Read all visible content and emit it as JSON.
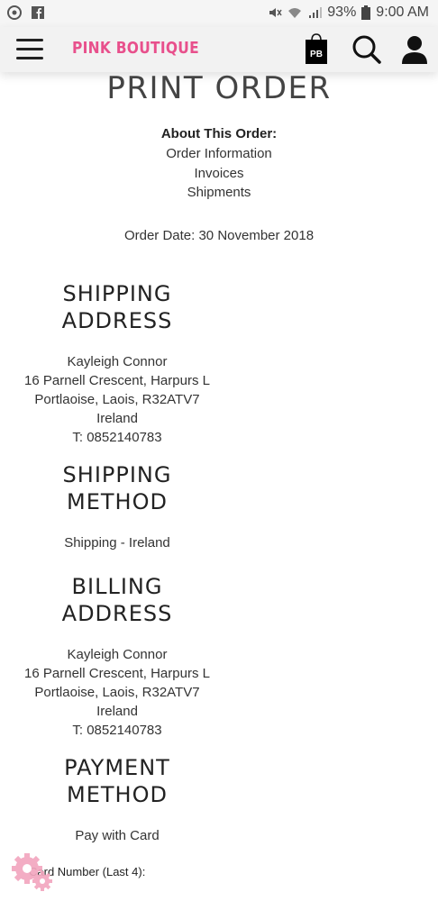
{
  "status_bar": {
    "battery": "93%",
    "time": "9:00 AM",
    "icons": [
      "chrome-icon",
      "facebook-icon",
      "mute-icon",
      "wifi-icon",
      "signal-icon",
      "battery-icon"
    ]
  },
  "header": {
    "brand": "PINK BOUTIQUE",
    "bag_label": "PB",
    "brand_color": "#e8508c"
  },
  "page": {
    "title": "PRINT ORDER",
    "about_heading": "About This Order:",
    "links": [
      "Order Information",
      "Invoices",
      "Shipments"
    ],
    "order_date": "Order Date: 30 November 2018"
  },
  "shipping_address": {
    "title_line1": "SHIPPING",
    "title_line2": "ADDRESS",
    "name": "Kayleigh Connor",
    "street": "16 Parnell Crescent, Harpurs L",
    "city": "Portlaoise, Laois, R32ATV7",
    "country": "Ireland",
    "phone": "T: 0852140783"
  },
  "shipping_method": {
    "title_line1": "SHIPPING",
    "title_line2": "METHOD",
    "value": "Shipping - Ireland"
  },
  "billing_address": {
    "title_line1": "BILLING",
    "title_line2": "ADDRESS",
    "name": "Kayleigh Connor",
    "street": "16 Parnell Crescent, Harpurs L",
    "city": "Portlaoise, Laois, R32ATV7",
    "country": "Ireland",
    "phone": "T: 0852140783"
  },
  "payment_method": {
    "title_line1": "PAYMENT",
    "title_line2": "METHOD",
    "value": "Pay with Card",
    "card_number_label": "Card Number (Last 4):"
  }
}
